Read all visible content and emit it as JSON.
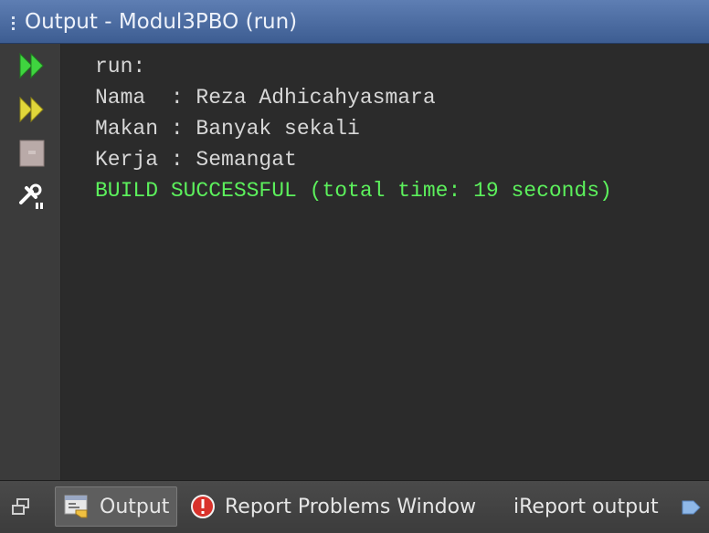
{
  "window": {
    "title": "Output - Modul3PBO (run)"
  },
  "toolbar": {
    "items": [
      {
        "name": "rerun",
        "icon": "double-play-icon",
        "color": "#3fd43f"
      },
      {
        "name": "rerun-with-options",
        "icon": "double-play-icon",
        "color": "#e0d63a"
      },
      {
        "name": "stop",
        "icon": "stop-icon",
        "color": "#b9aaa8"
      },
      {
        "name": "run-settings",
        "icon": "tools-icon",
        "color": "#ffffff"
      }
    ]
  },
  "output": {
    "lines": [
      {
        "text": "run:",
        "kind": "normal"
      },
      {
        "text": "Nama  : Reza Adhicahyasmara",
        "kind": "normal"
      },
      {
        "text": "Makan : Banyak sekali",
        "kind": "normal"
      },
      {
        "text": "Kerja : Semangat",
        "kind": "normal"
      },
      {
        "text": "BUILD SUCCESSFUL (total time: 19 seconds)",
        "kind": "success"
      }
    ],
    "text_color": "#d7d7d7",
    "success_color": "#5cf05c",
    "background": "#2b2b2b"
  },
  "tabs": {
    "restore_icon": "restore-window-icon",
    "items": [
      {
        "label": "Output",
        "icon": "output-window-icon",
        "active": true
      },
      {
        "label": "Report Problems Window",
        "icon": "error-icon",
        "active": false
      },
      {
        "label": "iReport output",
        "icon": "",
        "active": false
      }
    ],
    "more_icon": "more-tabs-arrow-icon"
  },
  "colors": {
    "title_bar": "#4a6ba3",
    "accent_error": "#d9322b"
  }
}
